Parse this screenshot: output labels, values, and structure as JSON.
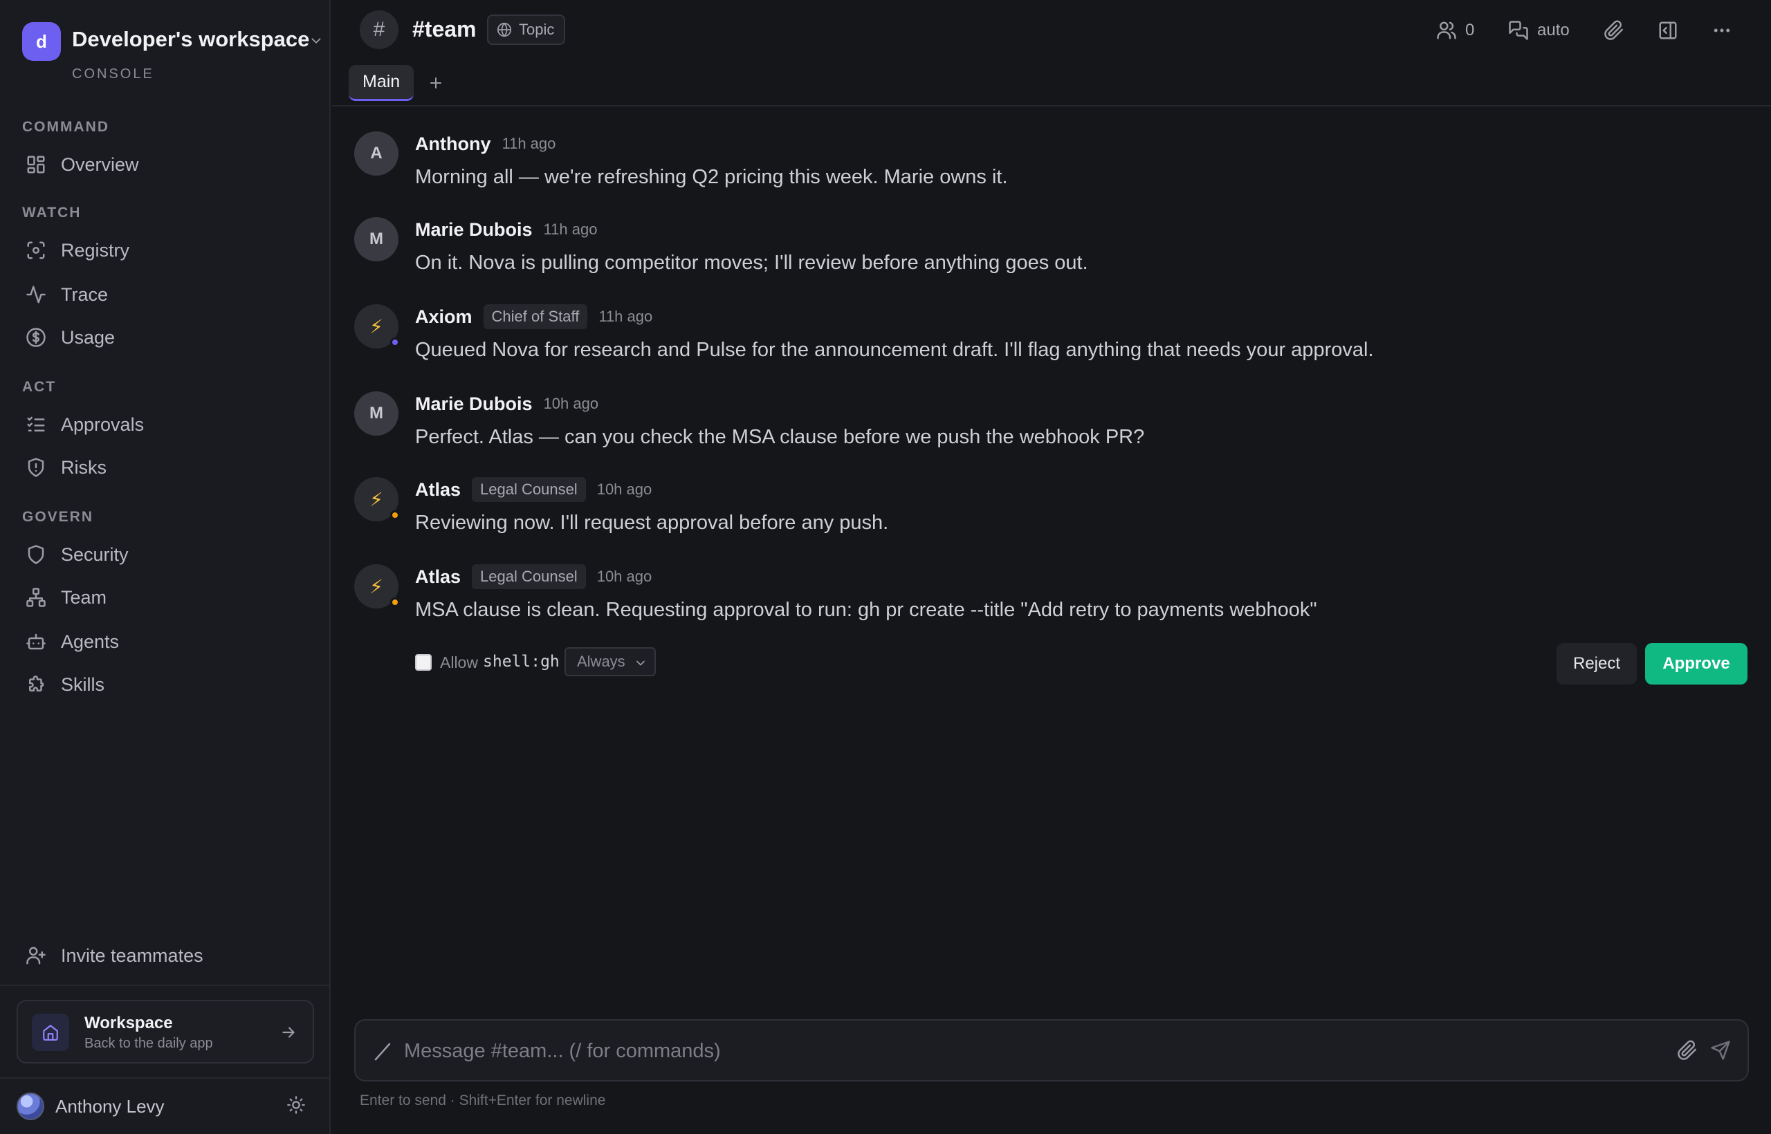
{
  "workspace": {
    "initial": "d",
    "name": "Developer's workspace",
    "subtitle": "CONSOLE"
  },
  "nav": {
    "sections": [
      {
        "label": "COMMAND",
        "items": [
          {
            "label": "Overview",
            "icon": "grid-icon"
          }
        ]
      },
      {
        "label": "WATCH",
        "items": [
          {
            "label": "Registry",
            "icon": "scan-icon"
          },
          {
            "label": "Trace",
            "icon": "activity-icon"
          },
          {
            "label": "Usage",
            "icon": "dollar-icon"
          }
        ]
      },
      {
        "label": "ACT",
        "items": [
          {
            "label": "Approvals",
            "icon": "list-check-icon"
          },
          {
            "label": "Risks",
            "icon": "shield-alert-icon"
          }
        ]
      },
      {
        "label": "GOVERN",
        "items": [
          {
            "label": "Security",
            "icon": "shield-icon"
          },
          {
            "label": "Team",
            "icon": "network-icon"
          },
          {
            "label": "Agents",
            "icon": "bot-icon"
          },
          {
            "label": "Skills",
            "icon": "puzzle-icon"
          }
        ]
      }
    ],
    "invite_label": "Invite teammates"
  },
  "workspace_card": {
    "title": "Workspace",
    "subtitle": "Back to the daily app"
  },
  "user": {
    "name": "Anthony Levy"
  },
  "channel": {
    "hash": "#",
    "title": "#team",
    "topic_label": "Topic",
    "members_count": "0",
    "reply_mode": "auto"
  },
  "tabs": {
    "main": "Main"
  },
  "messages": [
    {
      "initial": "A",
      "author": "Anthony",
      "time": "11h ago",
      "text": "Morning all — we're refreshing Q2 pricing this week. Marie owns it."
    },
    {
      "initial": "M",
      "author": "Marie Dubois",
      "time": "11h ago",
      "text": "On it. Nova is pulling competitor moves; I'll review before anything goes out."
    },
    {
      "initial": "⚡",
      "author": "Axiom",
      "role": "Chief of Staff",
      "time": "11h ago",
      "text": "Queued Nova for research and Pulse for the announcement draft. I'll flag anything that needs your approval.",
      "dot_color": "#6d5ff0"
    },
    {
      "initial": "M",
      "author": "Marie Dubois",
      "time": "10h ago",
      "text": "Perfect. Atlas — can you check the MSA clause before we push the webhook PR?"
    },
    {
      "initial": "⚡",
      "author": "Atlas",
      "role": "Legal Counsel",
      "time": "10h ago",
      "text": "Reviewing now. I'll request approval before any push.",
      "dot_color": "#f59e0b"
    },
    {
      "initial": "⚡",
      "author": "Atlas",
      "role": "Legal Counsel",
      "time": "10h ago",
      "text": "MSA clause is clean. Requesting approval to run: gh pr create --title \"Add retry to payments webhook\"",
      "dot_color": "#f59e0b"
    }
  ],
  "approval": {
    "allow_label": "Allow",
    "permission": "shell:gh",
    "scope_selected": "Always",
    "reject_label": "Reject",
    "approve_label": "Approve",
    "approve_color": "#10b981"
  },
  "composer": {
    "placeholder": "Message #team... (/ for commands)",
    "hint": "Enter to send · Shift+Enter for newline"
  },
  "colors": {
    "accent": "#6d5ff0",
    "background": "#15161a",
    "sidebar": "#1a1b20"
  }
}
